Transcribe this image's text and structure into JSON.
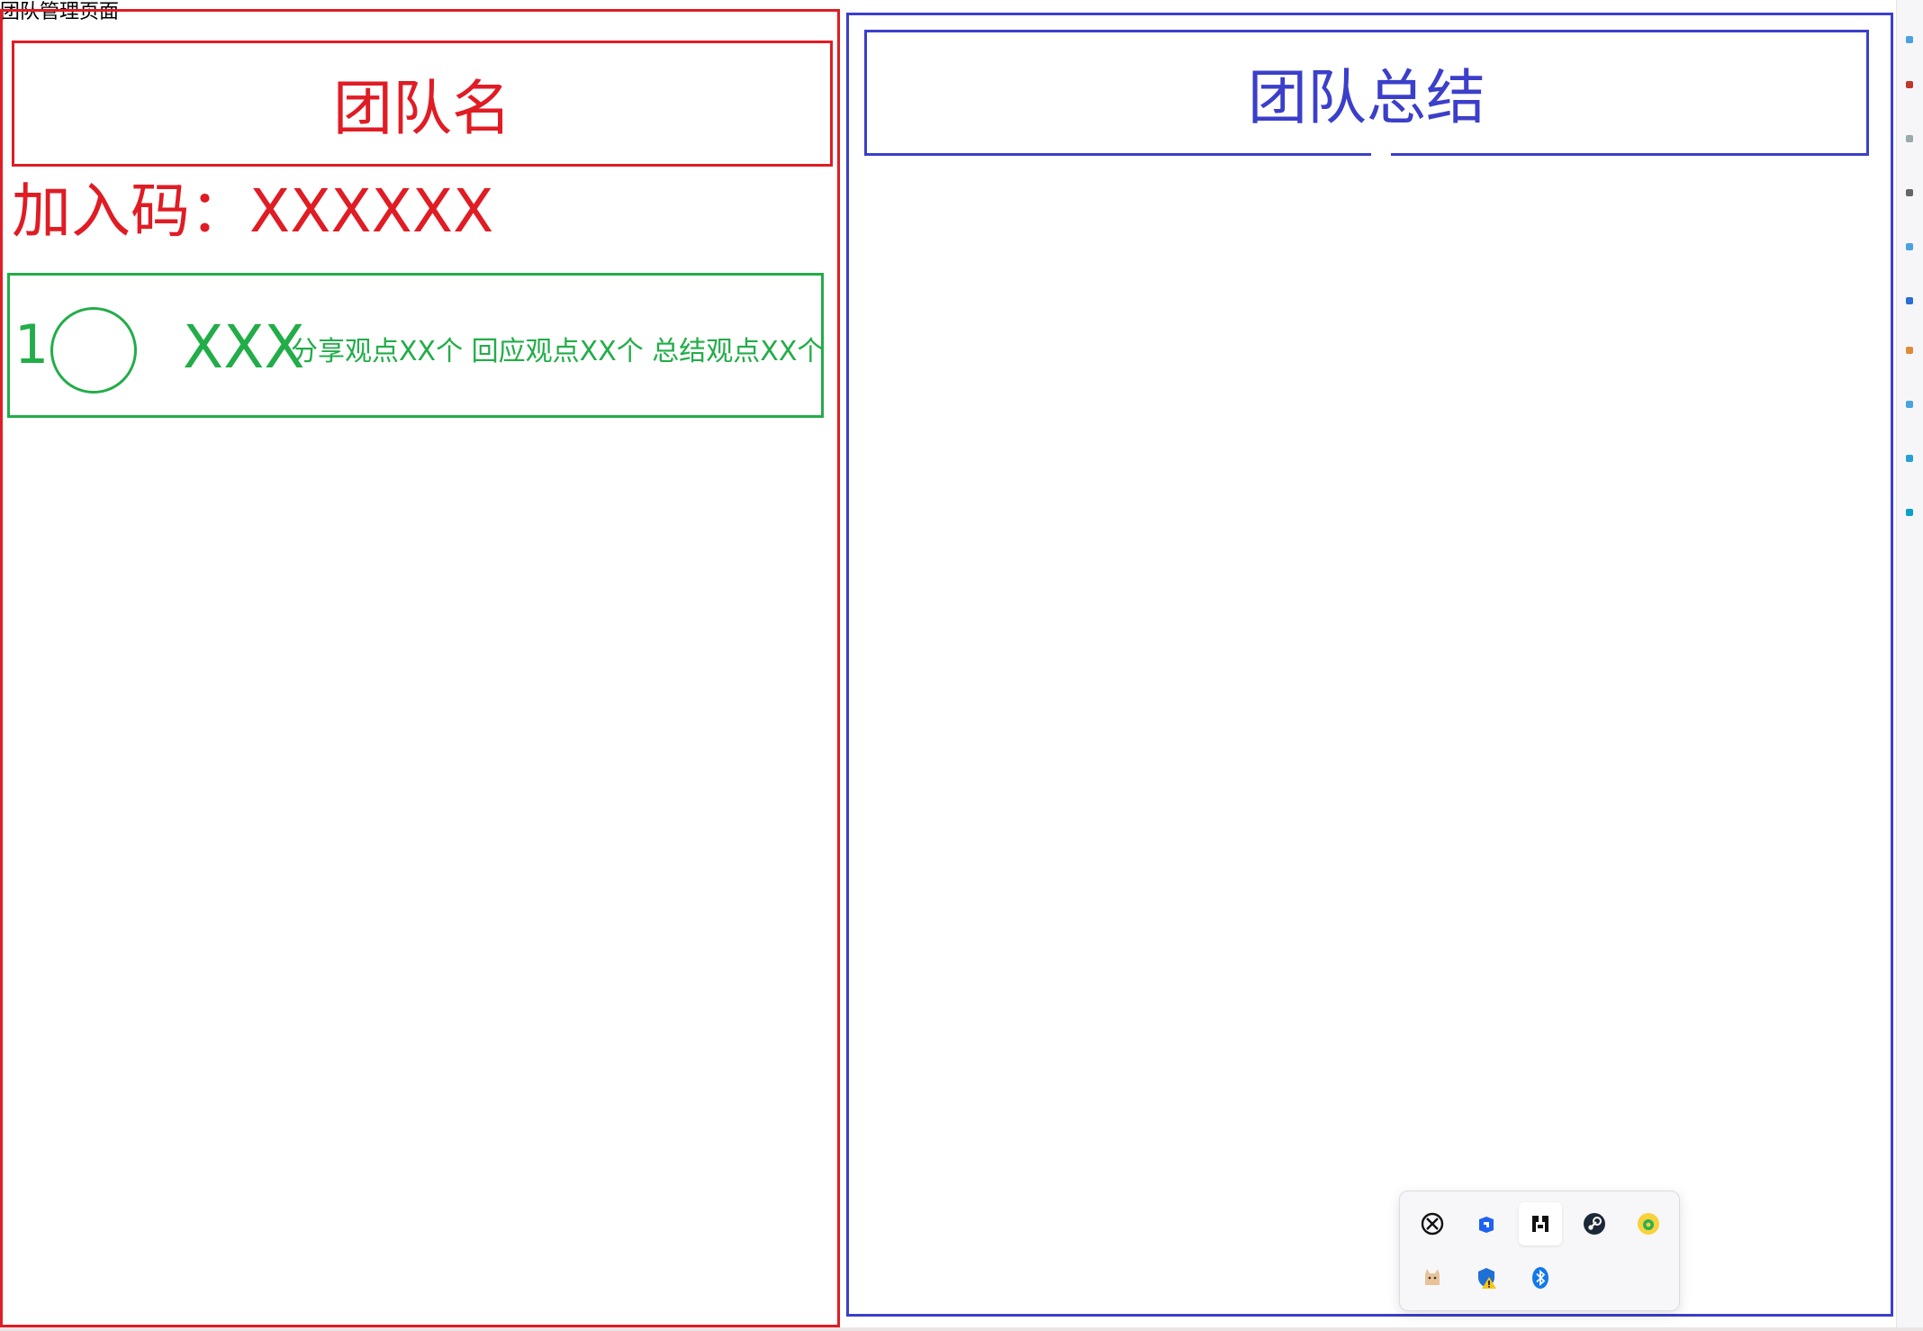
{
  "page": {
    "title": "团队管理页面"
  },
  "team": {
    "name": "团队名",
    "join_code_label": "加入码：",
    "join_code": "XXXXXX"
  },
  "members": [
    {
      "rank": "1",
      "name": "XXX",
      "stats": "分享观点XX个 回应观点XX个 总结观点XX个"
    }
  ],
  "summary": {
    "title": "团队总结"
  },
  "tray": {
    "icons": [
      "xbox-icon",
      "app-store-icon",
      "game-launcher-icon",
      "steam-icon",
      "music-icon",
      "cat-icon",
      "security-warning-icon",
      "bluetooth-icon"
    ]
  },
  "colors": {
    "left_accent": "#e01c24",
    "member_accent": "#22ad48",
    "right_accent": "#3b3fc9"
  }
}
